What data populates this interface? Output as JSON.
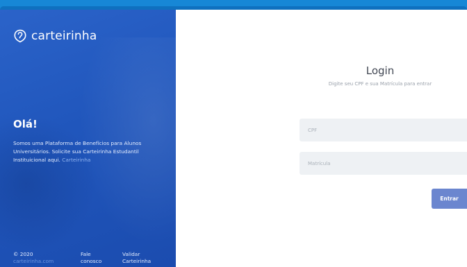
{
  "brand": {
    "name": "carteirinha",
    "icon": "pin-outline-icon"
  },
  "left_panel": {
    "greeting": "Olá!",
    "description": "Somos uma Plataforma de Benefícios para Alunos Universitários. Solicite sua Carteirinha Estudantil Instituicional aqui.",
    "description_link": "Carteirinha"
  },
  "footer": {
    "copyright": "© 2020",
    "site": "carteirinha.com",
    "contact_line1": "Fale",
    "contact_line2": "conosco",
    "validate_line1": "Validar",
    "validate_line2": "Carteirinha"
  },
  "login": {
    "title": "Login",
    "subtitle": "Digite seu CPF e sua Matrícula para entrar",
    "cpf_placeholder": "CPF",
    "matricula_placeholder": "Matrícula",
    "submit_label": "Entrar"
  },
  "colors": {
    "top_bar": "#1787d6",
    "panel_blue": "#2056bc",
    "button": "#6b86cf",
    "field_bg": "#eef1f4"
  }
}
